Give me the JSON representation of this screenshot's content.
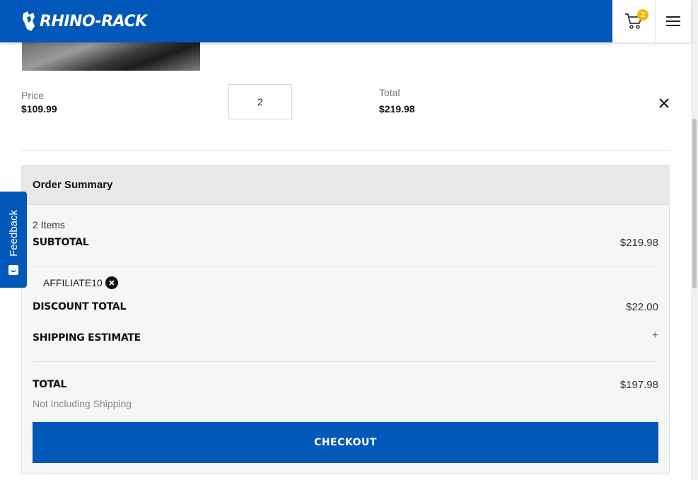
{
  "header": {
    "brand": "RHINO-RACK",
    "cart_count": "2",
    "cart_icon": "cart-icon",
    "menu_icon": "hamburger-menu-icon",
    "color": "#0158b8"
  },
  "cart_line": {
    "price_label": "Price",
    "price_value": "$109.99",
    "quantity": "2",
    "total_label": "Total",
    "total_value": "$219.98",
    "remove_icon": "close-icon"
  },
  "summary": {
    "title": "Order Summary",
    "items_count": "2 Items",
    "subtotal_label": "SUBTOTAL",
    "subtotal_value": "$219.98",
    "coupon_code": "AFFILIATE10",
    "discount_label": "DISCOUNT TOTAL",
    "discount_value": "$22.00",
    "shipping_label": "SHIPPING ESTIMATE",
    "shipping_toggle": "+",
    "total_label": "TOTAL",
    "total_value": "$197.98",
    "total_note": "Not Including Shipping",
    "checkout_label": "CHECKOUT"
  },
  "feedback": {
    "label": "Feedback"
  }
}
